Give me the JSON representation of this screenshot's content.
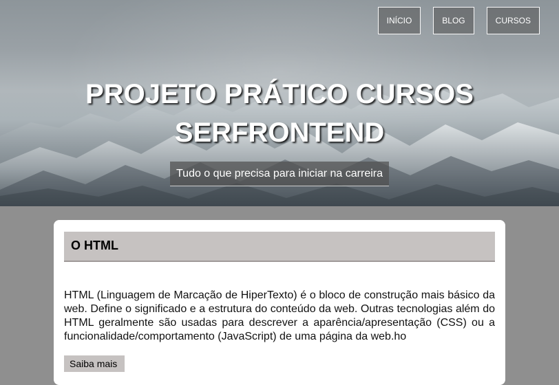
{
  "nav": {
    "items": [
      {
        "label": "INÍCIO"
      },
      {
        "label": "BLOG"
      },
      {
        "label": "CURSOS"
      }
    ]
  },
  "hero": {
    "title_line_1": "PROJETO PRÁTICO CURSOS",
    "title_line_2": "SERFRONTEND",
    "subtitle": "Tudo o que precisa para iniciar na carreira"
  },
  "article": {
    "heading": "O HTML",
    "body": "HTML (Linguagem de Marcação de HiperTexto) é o bloco de construção mais básico da web. Define o significado e a estrutura do conteúdo da web. Outras tecnologias além do HTML geralmente são usadas para descrever a aparência/apresentação (CSS) ou a funcionalidade/comportamento (JavaScript) de uma página da web.ho",
    "read_more_label": "Saiba mais"
  }
}
